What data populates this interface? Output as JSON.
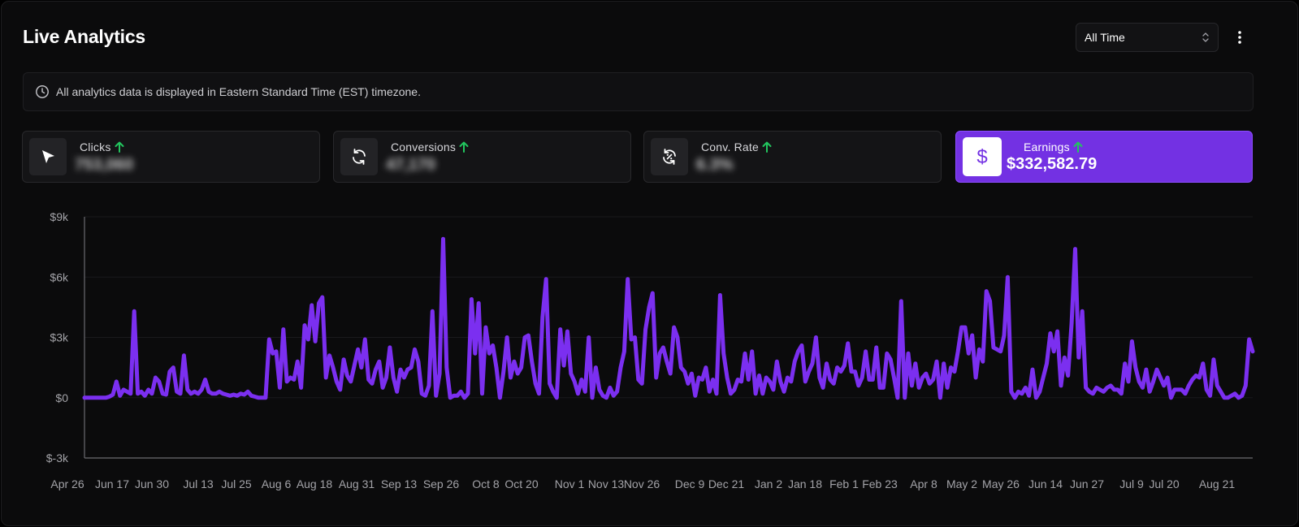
{
  "header": {
    "title": "Live Analytics",
    "range_select": {
      "value": "All Time"
    }
  },
  "banner": {
    "text": "All analytics data is displayed in Eastern Standard Time (EST) timezone."
  },
  "stats": [
    {
      "label": "Clicks",
      "value": "753,060",
      "icon": "cursor-icon",
      "trend": "up"
    },
    {
      "label": "Conversions",
      "value": "47,170",
      "icon": "refresh-icon",
      "trend": "up"
    },
    {
      "label": "Conv. Rate",
      "value": "6.3%",
      "icon": "percent-cycle-icon",
      "trend": "up"
    },
    {
      "label": "Earnings",
      "value": "$332,582.79",
      "icon": "dollar-icon",
      "trend": "up",
      "active": true
    }
  ],
  "colors": {
    "accent": "#7331e3",
    "line": "#7b2ff0",
    "trend_up": "#22c55e"
  },
  "chart_data": {
    "type": "line",
    "y_ticks": [
      "$9k",
      "$6k",
      "$3k",
      "$0",
      "$-3k"
    ],
    "ylim": [
      -3000,
      9000
    ],
    "x_ticks": [
      "Apr 26",
      "Jun 17",
      "Jun 30",
      "Jul 13",
      "Jul 25",
      "Aug 6",
      "Aug 18",
      "Aug 31",
      "Sep 13",
      "Sep 26",
      "Oct 8",
      "Oct 20",
      "Nov 1",
      "Nov 13",
      "Nov 26",
      "Dec 9",
      "Dec 21",
      "Jan 2",
      "Jan 18",
      "Feb 1",
      "Feb 23",
      "Apr 8",
      "May 2",
      "May 26",
      "Jun 14",
      "Jun 27",
      "Jul 9",
      "Jul 20",
      "Aug 21"
    ],
    "grid": true,
    "series": [
      {
        "values": [
          0,
          0,
          0,
          0,
          0,
          0,
          0,
          50,
          150,
          800,
          100,
          400,
          300,
          200,
          4300,
          200,
          300,
          100,
          400,
          200,
          1000,
          800,
          200,
          150,
          1300,
          1500,
          300,
          200,
          2100,
          400,
          200,
          300,
          200,
          400,
          900,
          300,
          200,
          200,
          300,
          200,
          150,
          100,
          150,
          100,
          200,
          150,
          300,
          100,
          50,
          0,
          0,
          0,
          2900,
          2200,
          2300,
          500,
          3400,
          800,
          1000,
          900,
          1800,
          500,
          3600,
          2900,
          4600,
          2800,
          4700,
          5000,
          1000,
          2100,
          1500,
          800,
          400,
          1900,
          1100,
          800,
          1600,
          2400,
          1500,
          2900,
          900,
          700,
          1400,
          1800,
          500,
          1000,
          2500,
          1000,
          300,
          1400,
          1000,
          1400,
          1500,
          2400,
          1800,
          200,
          100,
          600,
          4300,
          100,
          1200,
          7900,
          1500,
          0,
          100,
          100,
          300,
          0,
          200,
          4900,
          2200,
          4700,
          200,
          3500,
          2200,
          2600,
          1500,
          0,
          1300,
          3000,
          1000,
          1800,
          1200,
          1500,
          3000,
          3100,
          1800,
          700,
          200,
          4000,
          5900,
          700,
          300,
          0,
          3400,
          1600,
          3300,
          1200,
          800,
          200,
          900,
          300,
          3000,
          0,
          1500,
          400,
          100,
          0,
          500,
          100,
          300,
          1500,
          2300,
          5900,
          2900,
          3000,
          900,
          700,
          3400,
          4500,
          5200,
          1000,
          2200,
          2500,
          1800,
          1200,
          3500,
          3000,
          1500,
          1300,
          700,
          1200,
          100,
          1000,
          900,
          1500,
          300,
          900,
          200,
          5100,
          2200,
          1000,
          200,
          400,
          900,
          800,
          2200,
          900,
          2300,
          200,
          1100,
          200,
          1000,
          800,
          400,
          1800,
          800,
          300,
          1000,
          800,
          1800,
          2300,
          2600,
          800,
          1300,
          1700,
          3000,
          1000,
          500,
          1700,
          900,
          700,
          1500,
          1300,
          1600,
          2700,
          1300,
          1300,
          600,
          1000,
          2300,
          900,
          900,
          2500,
          500,
          500,
          2200,
          1900,
          1000,
          0,
          4800,
          0,
          2200,
          600,
          1700,
          500,
          1000,
          1200,
          700,
          900,
          1800,
          0,
          1700,
          500,
          1500,
          1300,
          2300,
          3500,
          3500,
          2200,
          3100,
          1000,
          2400,
          1800,
          5300,
          4800,
          2500,
          2400,
          2300,
          3100,
          6000,
          300,
          0,
          300,
          200,
          500,
          100,
          1400,
          0,
          300,
          1000,
          1700,
          3200,
          2300,
          3300,
          600,
          2000,
          1100,
          3700,
          7400,
          2000,
          4300,
          500,
          300,
          200,
          500,
          400,
          300,
          500,
          600,
          400,
          400,
          200,
          1700,
          800,
          2800,
          1500,
          800,
          500,
          1400,
          300,
          800,
          1400,
          1000,
          600,
          1000,
          0,
          400,
          400,
          400,
          200,
          600,
          900,
          1100,
          1000,
          1700,
          400,
          100,
          1900,
          600,
          300,
          0,
          0,
          100,
          200,
          0,
          100,
          600,
          2900,
          2300
        ]
      }
    ]
  }
}
